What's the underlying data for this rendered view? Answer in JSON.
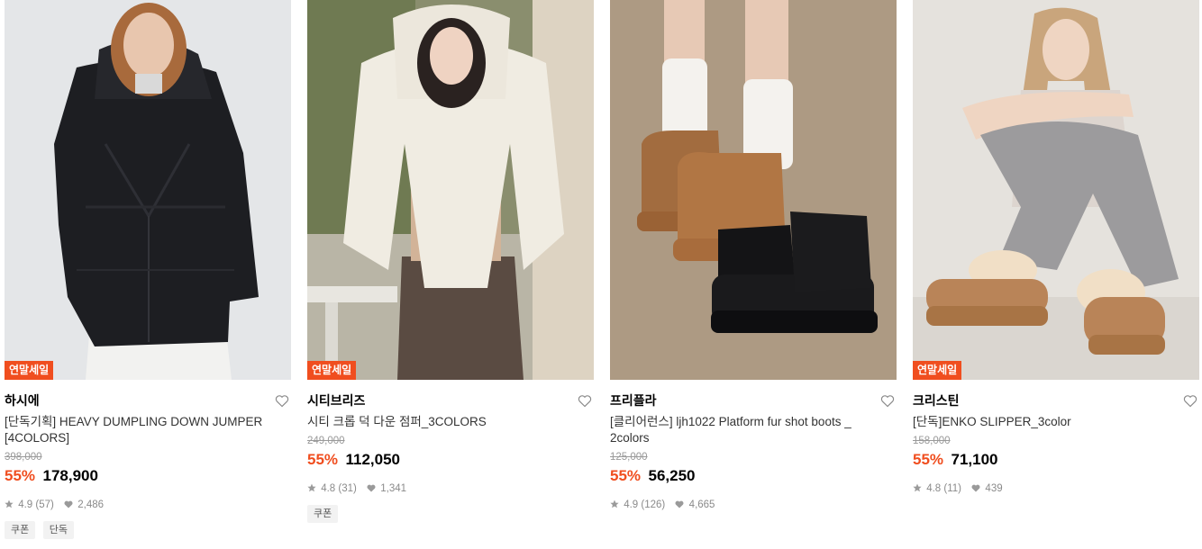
{
  "products": [
    {
      "badge": "연말세일",
      "brand": "하시에",
      "name": "[단독기획] HEAVY DUMPLING DOWN JUMPER [4COLORS]",
      "original_price": "398,000",
      "discount": "55%",
      "price": "178,900",
      "rating": "4.9",
      "reviews": "(57)",
      "likes": "2,486",
      "tags": [
        "쿠폰",
        "단독"
      ]
    },
    {
      "badge": "연말세일",
      "brand": "시티브리즈",
      "name": "시티 크롭 덕 다운 점퍼_3COLORS",
      "original_price": "249,000",
      "discount": "55%",
      "price": "112,050",
      "rating": "4.8",
      "reviews": "(31)",
      "likes": "1,341",
      "tags": [
        "쿠폰"
      ]
    },
    {
      "badge": "",
      "brand": "프리플라",
      "name": "[클리어런스] ljh1022 Platform fur shot boots _ 2colors",
      "original_price": "125,000",
      "discount": "55%",
      "price": "56,250",
      "rating": "4.9",
      "reviews": "(126)",
      "likes": "4,665",
      "tags": []
    },
    {
      "badge": "연말세일",
      "brand": "크리스틴",
      "name": "[단독]ENKO SLIPPER_3color",
      "original_price": "158,000",
      "discount": "55%",
      "price": "71,100",
      "rating": "4.8",
      "reviews": "(11)",
      "likes": "439",
      "tags": []
    }
  ],
  "colors": {
    "accent": "#f04e1f",
    "muted": "#9a9a9a"
  },
  "icons": {
    "wish": "heart-outline-icon",
    "rating": "star-icon",
    "likes": "heart-filled-icon"
  }
}
